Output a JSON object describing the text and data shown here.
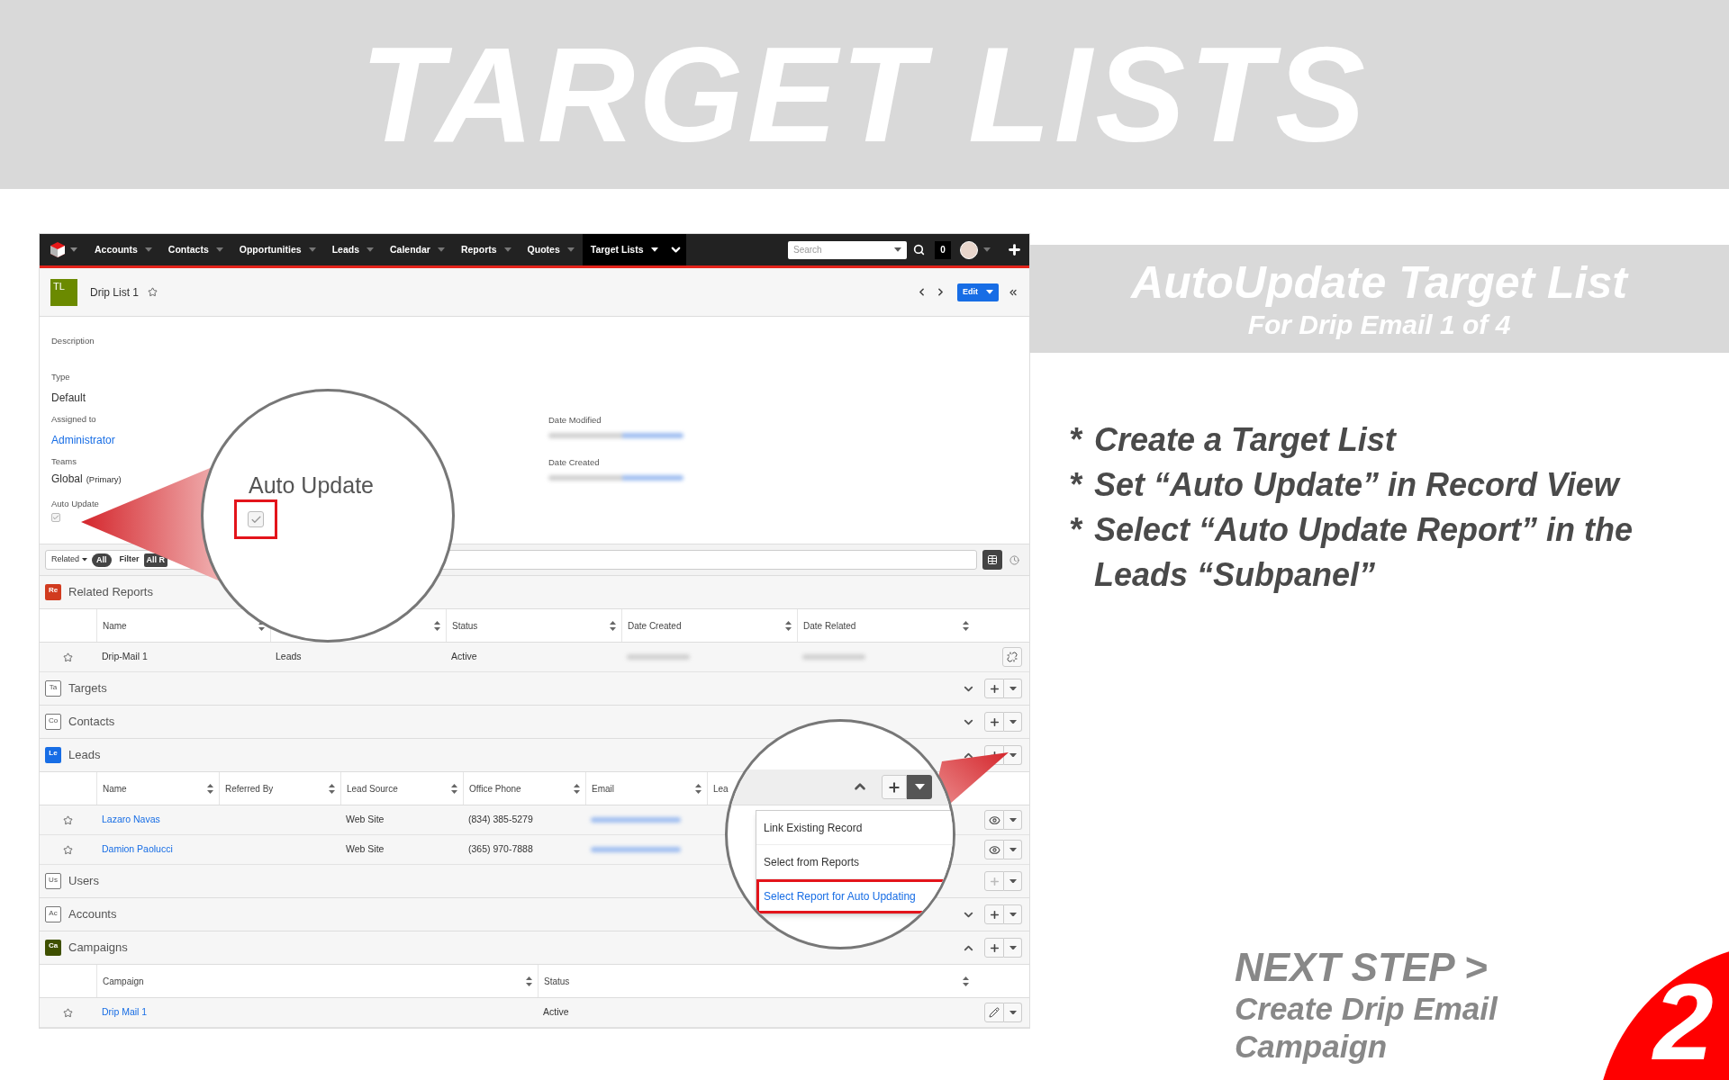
{
  "banner": {
    "title": "TARGET LISTS"
  },
  "app": {
    "nav": {
      "items": [
        {
          "label": "Accounts",
          "selected": false
        },
        {
          "label": "Contacts",
          "selected": false
        },
        {
          "label": "Opportunities",
          "selected": false
        },
        {
          "label": "Leads",
          "selected": false
        },
        {
          "label": "Calendar",
          "selected": false
        },
        {
          "label": "Reports",
          "selected": false
        },
        {
          "label": "Quotes",
          "selected": false
        },
        {
          "label": "Target Lists",
          "selected": true
        }
      ],
      "search": {
        "placeholder": "Search"
      },
      "notifications": "0"
    },
    "record": {
      "badge": "TL",
      "title": "Drip List 1",
      "favorite": false,
      "edit": "Edit"
    },
    "fields": {
      "description_label": "Description",
      "type_label": "Type",
      "type_value": "Default",
      "assigned_label": "Assigned to",
      "assigned_value": "Administrator",
      "teams_label": "Teams",
      "teams_value": "Global",
      "teams_note": "(Primary)",
      "auto_update_label": "Auto Update",
      "auto_update_checked": true,
      "date_modified_label": "Date Modified",
      "date_created_label": "Date Created"
    },
    "filter": {
      "related": "Related",
      "all": "All",
      "filter": "Filter",
      "filter_value": "All R"
    },
    "subpanels": [
      {
        "badge": "Re",
        "title": "Related Reports",
        "kind": "filled",
        "color": "#d13b1f",
        "table": {
          "columns": [
            "Name",
            null,
            "Status",
            "Date Created",
            "Date Related"
          ],
          "rows": [
            {
              "favorite": false,
              "kind": "unlink",
              "cells": [
                {
                  "kind": "text",
                  "text": "Drip-Mail 1"
                },
                {
                  "kind": "text",
                  "text": "Leads"
                },
                {
                  "kind": "text",
                  "text": "Active"
                },
                {
                  "kind": "blurred"
                },
                {
                  "kind": "blurred"
                }
              ]
            }
          ]
        }
      },
      {
        "badge": "Ta",
        "title": "Targets",
        "kind": "outline",
        "expanded": false,
        "add_button": {
          "disabled": false
        }
      },
      {
        "badge": "Co",
        "title": "Contacts",
        "kind": "outline",
        "expanded": false,
        "add_button": {
          "disabled": false
        }
      },
      {
        "badge": "Le",
        "title": "Leads",
        "kind": "filled",
        "color": "#176de5",
        "expanded": true,
        "add_button": {
          "disabled": false
        },
        "table": {
          "columns": [
            "Name",
            "Referred By",
            "Lead Source",
            "Office Phone",
            "Email",
            "Lea"
          ],
          "rows": [
            {
              "favorite": false,
              "kind": "view",
              "cells": [
                {
                  "kind": "link",
                  "text": "Lazaro Navas"
                },
                {
                  "kind": "empty"
                },
                {
                  "kind": "text",
                  "text": "Web Site"
                },
                {
                  "kind": "text",
                  "text": "(834) 385-5279"
                },
                {
                  "kind": "blurred_link"
                }
              ]
            },
            {
              "favorite": false,
              "kind": "view",
              "cells": [
                {
                  "kind": "link",
                  "text": "Damion Paolucci"
                },
                {
                  "kind": "empty"
                },
                {
                  "kind": "text",
                  "text": "Web Site"
                },
                {
                  "kind": "text",
                  "text": "(365) 970-7888"
                },
                {
                  "kind": "blurred_link"
                }
              ]
            }
          ]
        }
      },
      {
        "badge": "Us",
        "title": "Users",
        "kind": "outline",
        "add_button": {
          "disabled": true
        }
      },
      {
        "badge": "Ac",
        "title": "Accounts",
        "kind": "outline",
        "expanded": false,
        "add_button": {
          "disabled": false
        }
      },
      {
        "badge": "Ca",
        "title": "Campaigns",
        "kind": "filled",
        "color": "#3f5000",
        "expanded": true,
        "add_button": {
          "disabled": false
        },
        "table": {
          "columns": [
            "Campaign",
            "Status"
          ],
          "rows": [
            {
              "favorite": false,
              "kind": "edit",
              "cells": [
                {
                  "kind": "link",
                  "text": "Drip Mail 1"
                },
                {
                  "kind": "text",
                  "text": "Active"
                }
              ]
            }
          ]
        }
      }
    ]
  },
  "magnifier_1": {
    "label": "Auto Update",
    "checked": true
  },
  "magnifier_2": {
    "menu": [
      {
        "label": "Link Existing Record",
        "selected": false
      },
      {
        "label": "Select from Reports",
        "selected": false
      },
      {
        "label": "Select Report for Auto Updating",
        "selected": true
      }
    ]
  },
  "panel": {
    "title": "AutoUpdate Target List",
    "subtitle": "For Drip Email 1 of 4",
    "steps": [
      {
        "marker": "*",
        "text": "Create a Target List"
      },
      {
        "marker": "*",
        "text": "Set “Auto Update” in Record View"
      },
      {
        "marker": "*",
        "text": "Select “Auto Update Report” in the Leads “Subpanel”"
      }
    ]
  },
  "next_step": {
    "heading": "NEXT STEP >",
    "text": "Create Drip Email Campaign",
    "number": "2"
  }
}
